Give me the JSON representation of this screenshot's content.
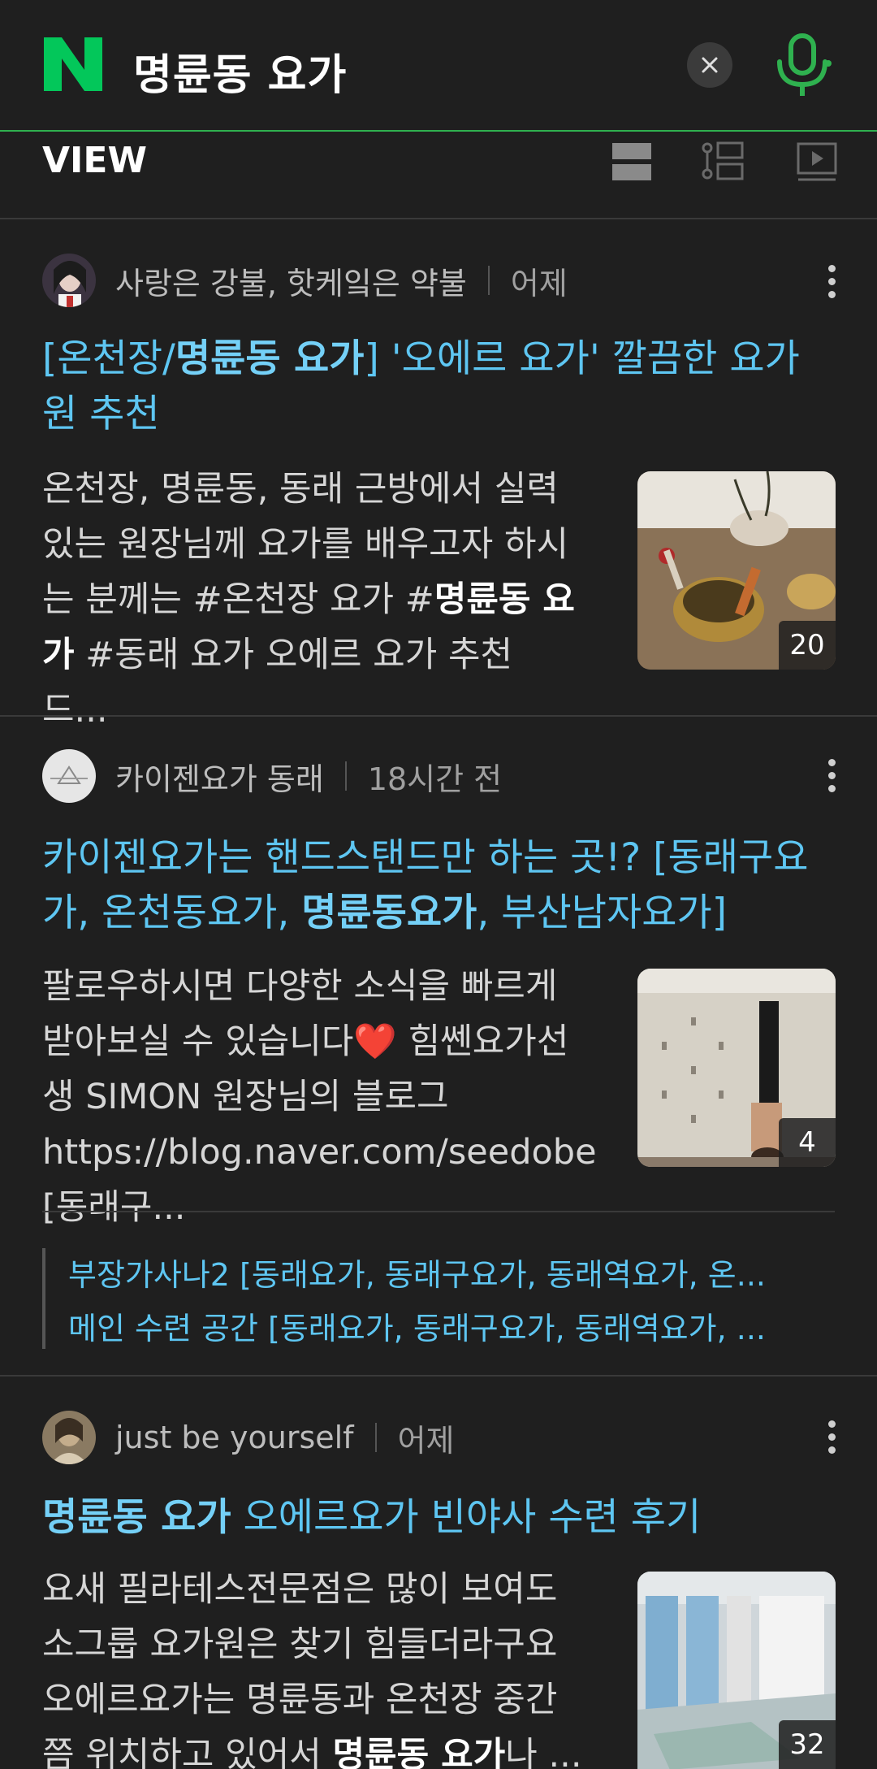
{
  "search": {
    "query": "명륜동 요가"
  },
  "view_tab": {
    "title": "VIEW"
  },
  "results": [
    {
      "author": "사랑은 강불, 핫케잌은 약불",
      "time": "어제",
      "title_pre": "[온천장/",
      "title_bold": "명륜동 요가",
      "title_post": "] '오에르 요가' 깔끔한 요가원 추천",
      "snippet_pre": "온천장, 명륜동, 동래 근방에서 실력 있는 원장님께 요가를 배우고자 하시는 분께는 #온천장 요가 #",
      "snippet_bold": "명륜동 요가",
      "snippet_post": " #동래 요가 오에르 요가 추천 드...",
      "image_count": "20"
    },
    {
      "author": "카이젠요가 동래",
      "time": "18시간 전",
      "title_pre": "카이젠요가는 핸드스탠드만 하는 곳!? [동래구요가, 온천동요가, ",
      "title_bold": "명륜동요가",
      "title_post": ", 부산남자요가]",
      "snippet_pre": "팔로우하시면 다양한 소식을 빠르게 받아보실 수 있습니다",
      "snippet_heart": "❤️",
      "snippet_post": " 힘쎈요가선생 SIMON 원장님의 블로그 https://blog.naver.com/seedobe [동래구...",
      "image_count": "4",
      "related": [
        "부장가사나2 [동래요가, 동래구요가, 동래역요가, 온...",
        "메인 수련 공간 [동래요가, 동래구요가, 동래역요가, ..."
      ]
    },
    {
      "author": "just be yourself",
      "time": "어제",
      "title_bold": "명륜동 요가",
      "title_post": " 오에르요가 빈야사 수련 후기",
      "snippet_pre": "요새 필라테스전문점은 많이 보여도 소그룹 요가원은 찾기 힘들더라구요 오에르요가는 명륜동과 온천장 중간쯤 위치하고 있어서 ",
      "snippet_bold": "명륜동 요가",
      "snippet_post": "나 ...",
      "image_count": "32"
    }
  ],
  "colors": {
    "accent_green": "#2fb14f",
    "link_blue": "#5ec6f2",
    "background": "#1f1f1f"
  }
}
